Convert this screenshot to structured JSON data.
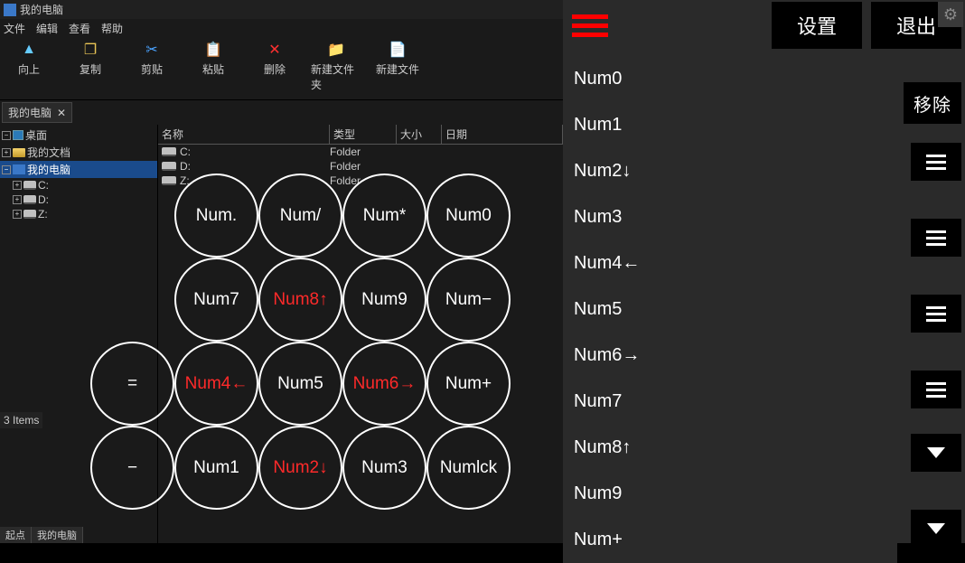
{
  "fm": {
    "title": "我的电脑",
    "menu": [
      "文件",
      "编辑",
      "查看",
      "帮助"
    ],
    "tools": [
      {
        "label": "向上",
        "icon": "▲",
        "cls": "up"
      },
      {
        "label": "复制",
        "icon": "❐",
        "cls": "copy"
      },
      {
        "label": "剪贴",
        "icon": "✂",
        "cls": "cut"
      },
      {
        "label": "粘贴",
        "icon": "📋",
        "cls": "paste"
      },
      {
        "label": "删除",
        "icon": "✕",
        "cls": "del"
      },
      {
        "label": "新建文件夹",
        "icon": "📁",
        "cls": "nf"
      },
      {
        "label": "新建文件",
        "icon": "📄",
        "cls": "nf"
      }
    ],
    "tab_label": "我的电脑",
    "tab_close": "✕",
    "tree": [
      {
        "label": "桌面",
        "indent": 0,
        "exp": "−",
        "icon": "dkt"
      },
      {
        "label": "我的文档",
        "indent": 0,
        "exp": "+",
        "icon": "fld"
      },
      {
        "label": "我的电脑",
        "indent": 0,
        "exp": "−",
        "icon": "pc",
        "sel": true
      },
      {
        "label": "C:",
        "indent": 1,
        "exp": "+",
        "icon": "drv"
      },
      {
        "label": "D:",
        "indent": 1,
        "exp": "+",
        "icon": "drv"
      },
      {
        "label": "Z:",
        "indent": 1,
        "exp": "+",
        "icon": "drv"
      }
    ],
    "columns": {
      "name": "名称",
      "type": "类型",
      "size": "大小",
      "date": "日期"
    },
    "rows": [
      {
        "name": "C:",
        "type": "Folder"
      },
      {
        "name": "D:",
        "type": "Folder"
      },
      {
        "name": "Z:",
        "type": "Folder"
      }
    ],
    "status": "3 Items",
    "footer": [
      "起点",
      "我的电脑"
    ]
  },
  "keypad_rows": [
    [
      null,
      {
        "t": "Num."
      },
      {
        "t": "Num/"
      },
      {
        "t": "Num*"
      },
      {
        "t": "Num0"
      }
    ],
    [
      null,
      {
        "t": "Num7"
      },
      {
        "t": "Num8↑",
        "red": true
      },
      {
        "t": "Num9"
      },
      {
        "t": "Num−"
      }
    ],
    [
      {
        "t": "="
      },
      {
        "t": "Num4←",
        "red": true
      },
      {
        "t": "Num5"
      },
      {
        "t": "Num6→",
        "red": true
      },
      {
        "t": "Num+"
      }
    ],
    [
      {
        "t": "−"
      },
      {
        "t": "Num1"
      },
      {
        "t": "Num2↓",
        "red": true
      },
      {
        "t": "Num3"
      },
      {
        "t": "Numlck"
      }
    ]
  ],
  "panel": {
    "settings": "设置",
    "exit": "退出",
    "trash": "移除",
    "numlist": [
      "Num0",
      "Num1",
      "Num2↓",
      "Num3",
      "Num4←",
      "Num5",
      "Num6→",
      "Num7",
      "Num8↑",
      "Num9",
      "Num+"
    ],
    "side_slots": [
      102,
      186,
      270,
      354
    ],
    "dd_slots": [
      424,
      508
    ]
  }
}
